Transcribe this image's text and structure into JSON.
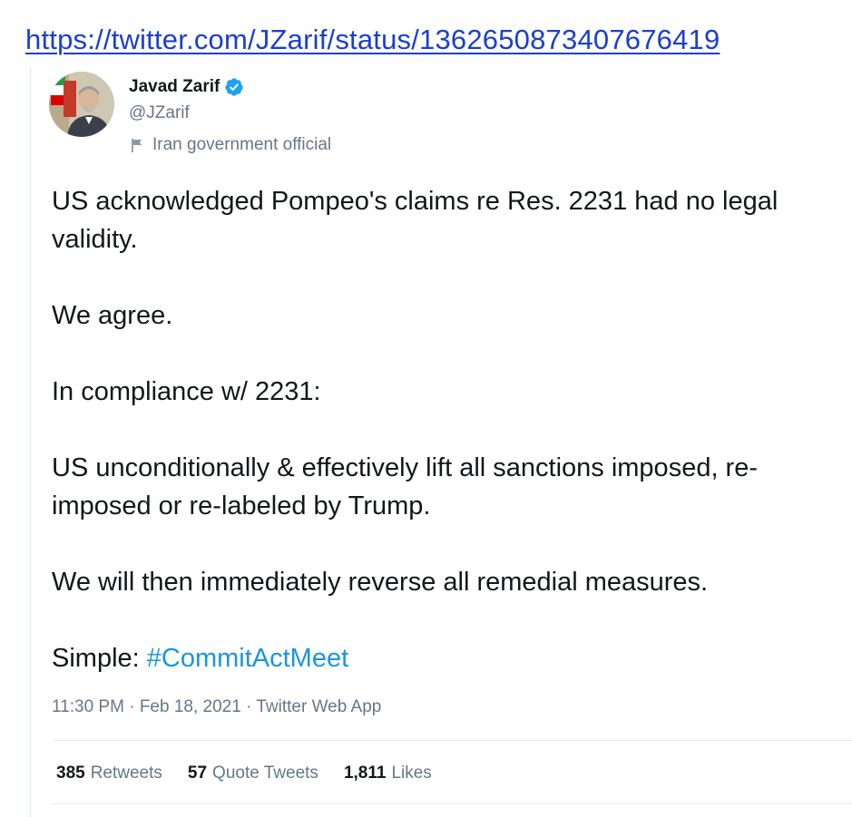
{
  "url": "https://twitter.com/JZarif/status/1362650873407676419",
  "author": {
    "name": "Javad Zarif",
    "handle": "@JZarif",
    "label": "Iran government official",
    "verified": true,
    "avatar_icon": "profile-photo"
  },
  "tweet": {
    "p1": "US acknowledged Pompeo's claims re Res. 2231 had no legal validity.",
    "p2": "We agree.",
    "p3": "In compliance w/ 2231:",
    "p4": "US unconditionally & effectively lift all sanctions imposed, re-imposed or re-labeled by Trump.",
    "p5": "We will then immediately reverse all remedial measures.",
    "p6_prefix": "Simple: ",
    "p6_hashtag": "#CommitActMeet"
  },
  "meta": {
    "time": "11:30 PM",
    "date": "Feb 18, 2021",
    "source": "Twitter Web App",
    "separator": " · "
  },
  "stats": {
    "retweets_count": "385",
    "retweets_label": "Retweets",
    "quotes_count": "57",
    "quotes_label": "Quote Tweets",
    "likes_count": "1,811",
    "likes_label": "Likes"
  },
  "colors": {
    "link": "#1a3fcf",
    "hashtag": "#1b95e0",
    "verified": "#1da1f2",
    "muted": "#657786",
    "text": "#14171a"
  }
}
